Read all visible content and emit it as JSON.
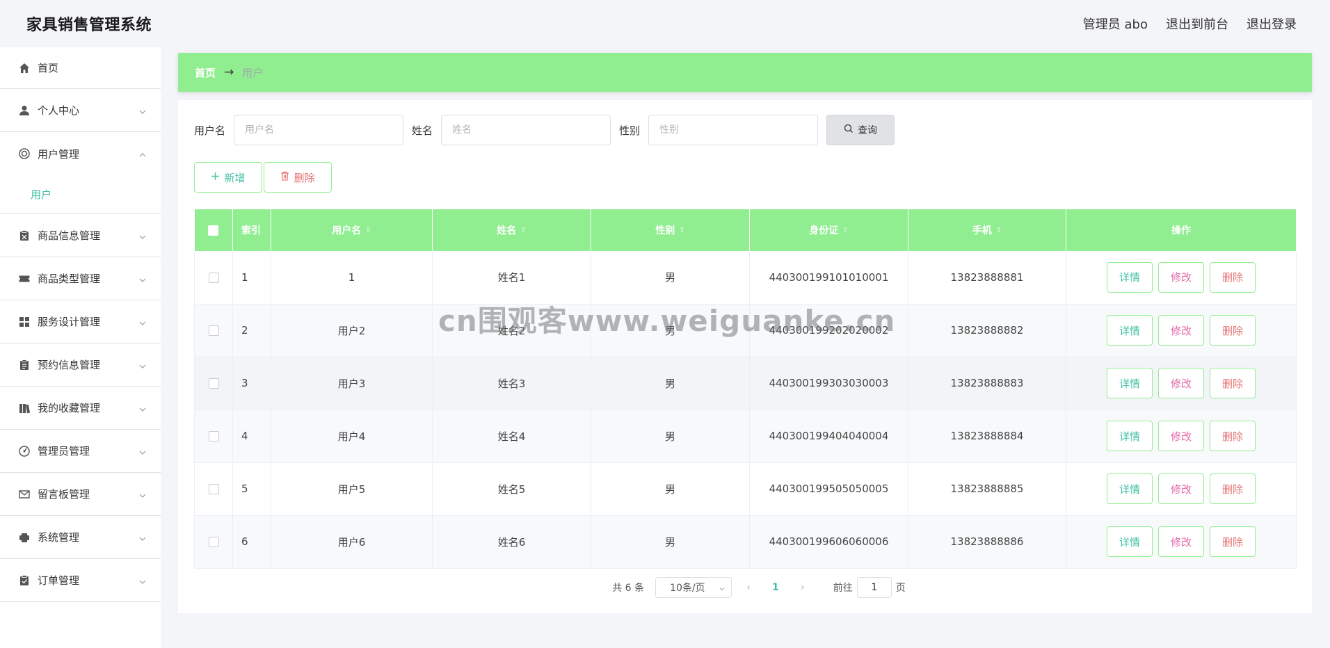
{
  "header": {
    "title": "家具销售管理系统",
    "admin": "管理员 abo",
    "to_front": "退出到前台",
    "logout": "退出登录"
  },
  "sidebar": {
    "items": [
      {
        "label": "首页",
        "icon": "home-icon"
      },
      {
        "label": "个人中心",
        "icon": "user-icon"
      },
      {
        "label": "用户管理",
        "icon": "lifebuoy-icon",
        "sub": "用户"
      },
      {
        "label": "商品信息管理",
        "icon": "clipboard-icon"
      },
      {
        "label": "商品类型管理",
        "icon": "ticket-icon"
      },
      {
        "label": "服务设计管理",
        "icon": "grid-icon"
      },
      {
        "label": "预约信息管理",
        "icon": "clipboard-list-icon"
      },
      {
        "label": "我的收藏管理",
        "icon": "books-icon"
      },
      {
        "label": "管理员管理",
        "icon": "gauge-icon"
      },
      {
        "label": "留言板管理",
        "icon": "mail-icon"
      },
      {
        "label": "系统管理",
        "icon": "printer-icon"
      },
      {
        "label": "订单管理",
        "icon": "clipboard-check-icon"
      }
    ]
  },
  "breadcrumb": {
    "home": "首页",
    "sep": "→",
    "current": "用户"
  },
  "search": {
    "username_label": "用户名",
    "username_placeholder": "用户名",
    "name_label": "姓名",
    "name_placeholder": "姓名",
    "gender_label": "性别",
    "gender_placeholder": "性别",
    "button": "查询"
  },
  "actions": {
    "add": "新增",
    "delete": "删除"
  },
  "table": {
    "headers": [
      "索引",
      "用户名",
      "姓名",
      "性别",
      "身份证",
      "手机",
      "操作"
    ],
    "rows": [
      {
        "idx": "1",
        "username": "1",
        "name": "姓名1",
        "gender": "男",
        "id_card": "440300199101010001",
        "phone": "13823888881"
      },
      {
        "idx": "2",
        "username": "用户2",
        "name": "姓名2",
        "gender": "男",
        "id_card": "440300199202020002",
        "phone": "13823888882"
      },
      {
        "idx": "3",
        "username": "用户3",
        "name": "姓名3",
        "gender": "男",
        "id_card": "440300199303030003",
        "phone": "13823888883"
      },
      {
        "idx": "4",
        "username": "用户4",
        "name": "姓名4",
        "gender": "男",
        "id_card": "440300199404040004",
        "phone": "13823888884"
      },
      {
        "idx": "5",
        "username": "用户5",
        "name": "姓名5",
        "gender": "男",
        "id_card": "440300199505050005",
        "phone": "13823888885"
      },
      {
        "idx": "6",
        "username": "用户6",
        "name": "姓名6",
        "gender": "男",
        "id_card": "440300199606060006",
        "phone": "13823888886"
      }
    ],
    "op_detail": "详情",
    "op_edit": "修改",
    "op_delete": "删除"
  },
  "pagination": {
    "total": "共 6 条",
    "page_size": "10条/页",
    "current_page": "1",
    "goto_label": "前往",
    "goto_value": "1",
    "page_suffix": "页"
  },
  "watermark": "cn围观客www.weiguanke.cn",
  "colors": {
    "accent_green": "#90ee90",
    "teal": "#3ebfa3",
    "pink": "#e36aa8",
    "red": "#e57373"
  }
}
